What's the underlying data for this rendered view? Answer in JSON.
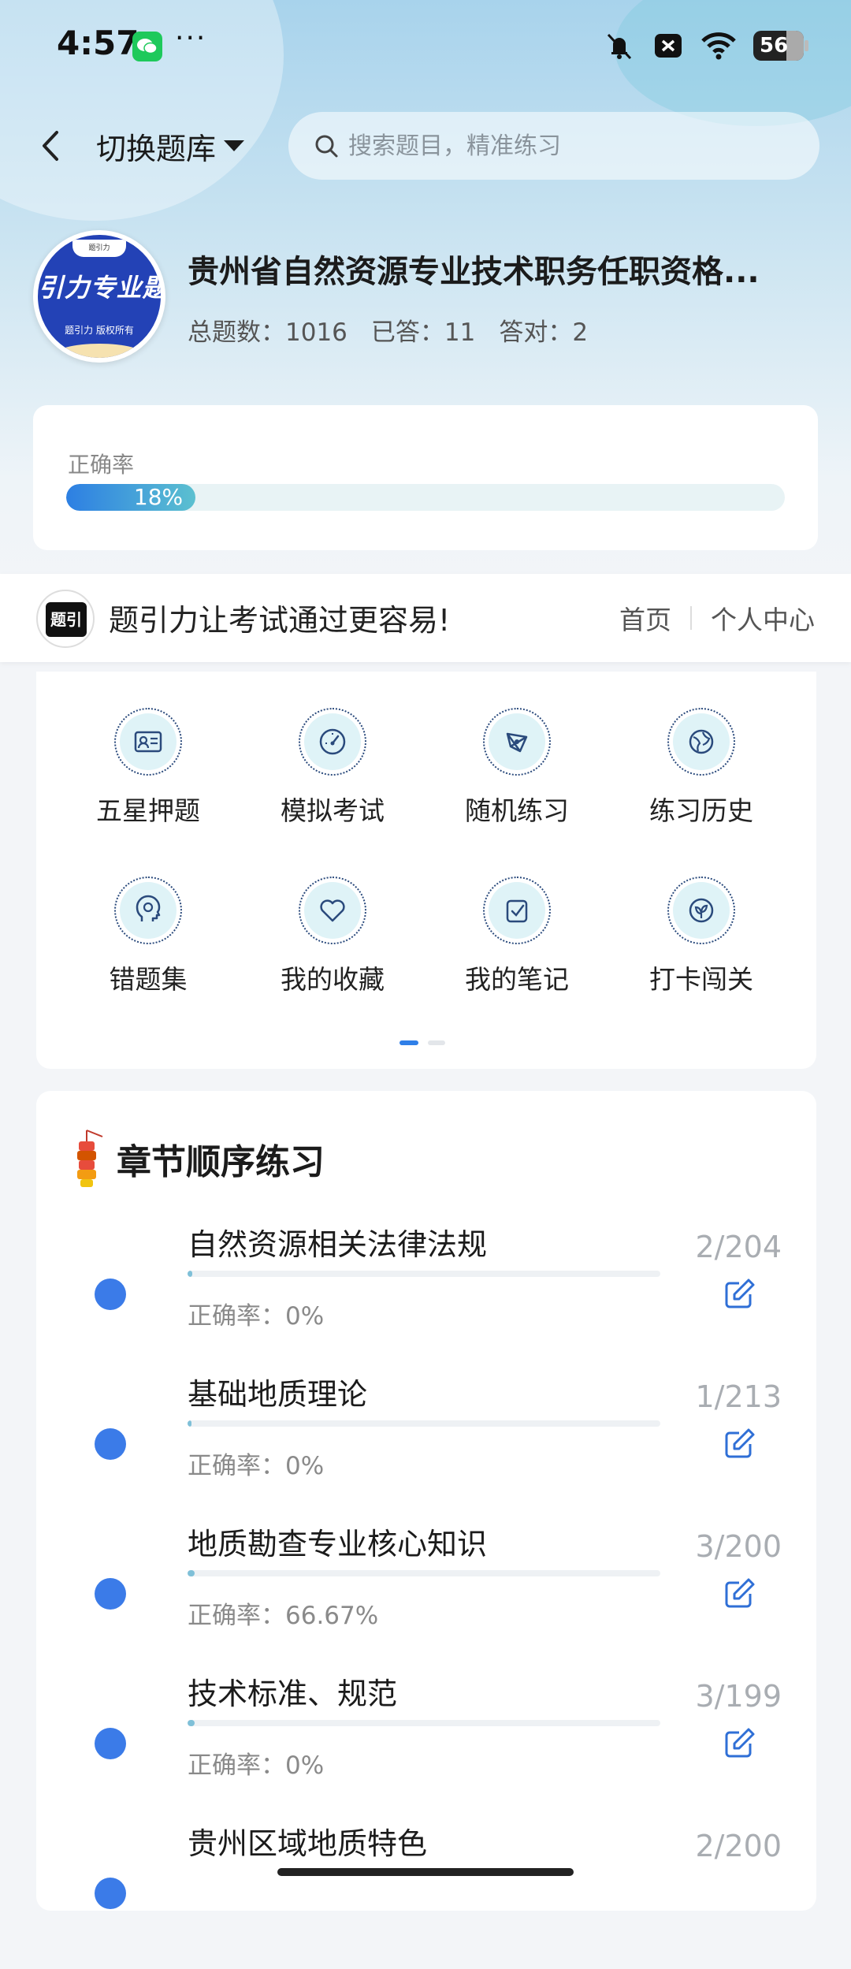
{
  "status_bar": {
    "time": "4:57",
    "more": "···",
    "battery": "56"
  },
  "header": {
    "switch_label": "切换题库",
    "search_placeholder": "搜索题目，精准练习"
  },
  "bank": {
    "logo_text": "引力专业题",
    "logo_cap": "题引力",
    "logo_sub": "题引力 版权所有",
    "title": "贵州省自然资源专业技术职务任职资格...",
    "stats": {
      "total": "总题数：1016",
      "answered": "已答：11",
      "correct": "答对：2"
    }
  },
  "accuracy": {
    "label": "正确率",
    "value_text": "18%",
    "value": 18
  },
  "brand_bar": {
    "logo_text": "题引力",
    "slogan": "题引力让考试通过更容易!",
    "nav": [
      "首页",
      "个人中心"
    ]
  },
  "functions": [
    {
      "label": "五星押题",
      "icon": "id-card-icon"
    },
    {
      "label": "模拟考试",
      "icon": "gauge-icon"
    },
    {
      "label": "随机练习",
      "icon": "network-icon"
    },
    {
      "label": "练习历史",
      "icon": "globe-icon"
    },
    {
      "label": "错题集",
      "icon": "head-icon"
    },
    {
      "label": "我的收藏",
      "icon": "heart-icon"
    },
    {
      "label": "我的笔记",
      "icon": "note-check-icon"
    },
    {
      "label": "打卡闯关",
      "icon": "leaf-icon"
    }
  ],
  "chapters": {
    "title": "章节顺序练习",
    "items": [
      {
        "name": "自然资源相关法律法规",
        "count": "2/204",
        "accuracy": "正确率：0%",
        "progress": 0.0098
      },
      {
        "name": "基础地质理论",
        "count": "1/213",
        "accuracy": "正确率：0%",
        "progress": 0.0047
      },
      {
        "name": "地质勘查专业核心知识",
        "count": "3/200",
        "accuracy": "正确率：66.67%",
        "progress": 0.015
      },
      {
        "name": "技术标准、规范",
        "count": "3/199",
        "accuracy": "正确率：0%",
        "progress": 0.015
      },
      {
        "name": "贵州区域地质特色",
        "count": "2/200",
        "accuracy": "",
        "progress": 0.01
      }
    ]
  },
  "colors": {
    "accent": "#2f7fe8",
    "dot": "#3b7be8",
    "icon_stroke": "#2a4a7c",
    "icon_bg": "#dff3f7"
  }
}
